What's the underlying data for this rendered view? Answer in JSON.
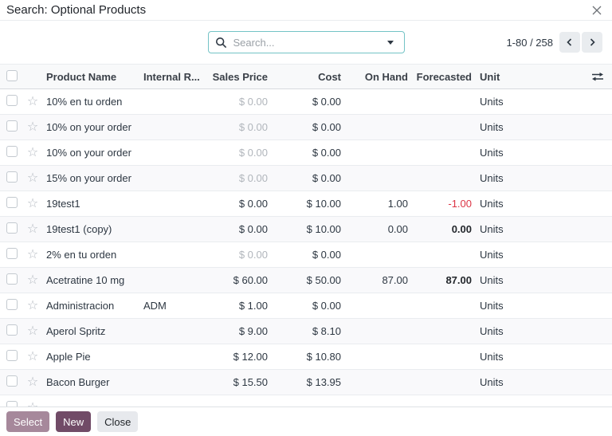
{
  "colors": {
    "primary": "#714B67",
    "primary_disabled": "#a6889b",
    "search_border": "#74c3c6",
    "negative": "#dc3545",
    "header_bg": "#f8f9fa",
    "zebra": "#f9f9fb",
    "border": "#e9ecef",
    "muted_text": "#b1b6bc",
    "text": "#2d3742"
  },
  "dialog": {
    "title": "Search: Optional Products",
    "close_icon": "close-x"
  },
  "toolbar": {
    "search": {
      "placeholder": "Search...",
      "icon": "magnifier",
      "caret_icon": "dropdown-caret"
    },
    "pager": {
      "range": "1-80 / 258",
      "prev_icon": "chevron-left",
      "next_icon": "chevron-right"
    }
  },
  "table": {
    "columns": [
      {
        "label": "Product Name"
      },
      {
        "label": "Internal R..."
      },
      {
        "label": "Sales Price"
      },
      {
        "label": "Cost"
      },
      {
        "label": "On Hand"
      },
      {
        "label": "Forecasted"
      },
      {
        "label": "Unit"
      }
    ],
    "options_icon": "adjust-columns",
    "rows": [
      {
        "name": "10% en tu orden",
        "internal_ref": "",
        "sales_price": "$ 0.00",
        "sales_muted": true,
        "cost": "$ 0.00",
        "on_hand": "",
        "forecasted": "",
        "forecast_style": "",
        "unit": "Units"
      },
      {
        "name": "10% on your order",
        "internal_ref": "",
        "sales_price": "$ 0.00",
        "sales_muted": true,
        "cost": "$ 0.00",
        "on_hand": "",
        "forecasted": "",
        "forecast_style": "",
        "unit": "Units"
      },
      {
        "name": "10% on your order",
        "internal_ref": "",
        "sales_price": "$ 0.00",
        "sales_muted": true,
        "cost": "$ 0.00",
        "on_hand": "",
        "forecasted": "",
        "forecast_style": "",
        "unit": "Units"
      },
      {
        "name": "15% on your order",
        "internal_ref": "",
        "sales_price": "$ 0.00",
        "sales_muted": true,
        "cost": "$ 0.00",
        "on_hand": "",
        "forecasted": "",
        "forecast_style": "",
        "unit": "Units"
      },
      {
        "name": "19test1",
        "internal_ref": "",
        "sales_price": "$ 0.00",
        "sales_muted": false,
        "cost": "$ 10.00",
        "on_hand": "1.00",
        "forecasted": "-1.00",
        "forecast_style": "negative",
        "unit": "Units"
      },
      {
        "name": "19test1 (copy)",
        "internal_ref": "",
        "sales_price": "$ 0.00",
        "sales_muted": false,
        "cost": "$ 10.00",
        "on_hand": "0.00",
        "forecasted": "0.00",
        "forecast_style": "emphasis",
        "unit": "Units"
      },
      {
        "name": "2% en tu orden",
        "internal_ref": "",
        "sales_price": "$ 0.00",
        "sales_muted": true,
        "cost": "$ 0.00",
        "on_hand": "",
        "forecasted": "",
        "forecast_style": "",
        "unit": "Units"
      },
      {
        "name": "Acetratine 10 mg",
        "internal_ref": "",
        "sales_price": "$ 60.00",
        "sales_muted": false,
        "cost": "$ 50.00",
        "on_hand": "87.00",
        "forecasted": "87.00",
        "forecast_style": "emphasis",
        "unit": "Units"
      },
      {
        "name": "Administracion",
        "internal_ref": "ADM",
        "sales_price": "$ 1.00",
        "sales_muted": false,
        "cost": "$ 0.00",
        "on_hand": "",
        "forecasted": "",
        "forecast_style": "",
        "unit": "Units"
      },
      {
        "name": "Aperol Spritz",
        "internal_ref": "",
        "sales_price": "$ 9.00",
        "sales_muted": false,
        "cost": "$ 8.10",
        "on_hand": "",
        "forecasted": "",
        "forecast_style": "",
        "unit": "Units"
      },
      {
        "name": "Apple Pie",
        "internal_ref": "",
        "sales_price": "$ 12.00",
        "sales_muted": false,
        "cost": "$ 10.80",
        "on_hand": "",
        "forecasted": "",
        "forecast_style": "",
        "unit": "Units"
      },
      {
        "name": "Bacon Burger",
        "internal_ref": "",
        "sales_price": "$ 15.50",
        "sales_muted": false,
        "cost": "$ 13.95",
        "on_hand": "",
        "forecasted": "",
        "forecast_style": "",
        "unit": "Units"
      },
      {
        "name": "",
        "internal_ref": "",
        "sales_price": "",
        "sales_muted": false,
        "cost": "",
        "on_hand": "",
        "forecasted": "",
        "forecast_style": "",
        "unit": ""
      }
    ]
  },
  "footer": {
    "select_label": "Select",
    "new_label": "New",
    "close_label": "Close"
  }
}
